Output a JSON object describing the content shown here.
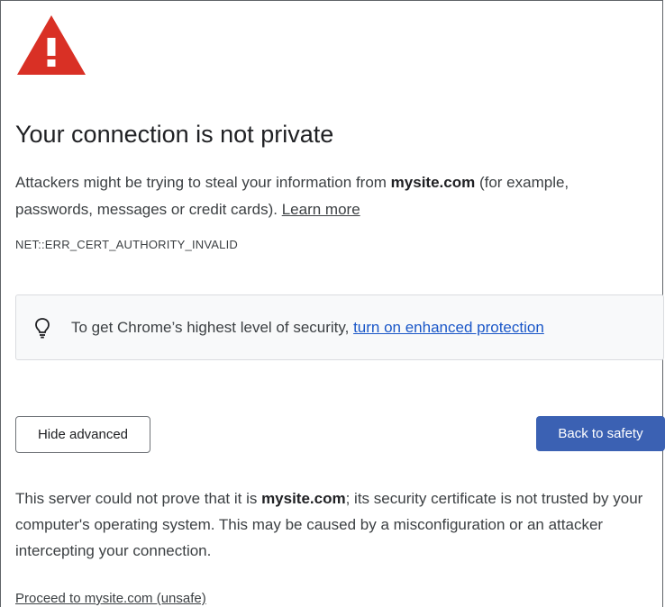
{
  "icons": {
    "warning": "warning-triangle-icon",
    "bulb": "lightbulb-icon"
  },
  "colors": {
    "warning_red": "#d93025",
    "link_blue": "#1a57c8",
    "primary_button": "#3b61b3",
    "box_background": "#f8f9fa"
  },
  "heading": "Your connection is not private",
  "description": {
    "part1": "Attackers might be trying to steal your information from ",
    "site": "mysite.com",
    "part2": " (for example, passwords, messages or credit cards). ",
    "learn_more": "Learn more"
  },
  "error_code": "NET::ERR_CERT_AUTHORITY_INVALID",
  "enhanced_protection": {
    "text": "To get Chrome’s highest level of security, ",
    "link": "turn on enhanced protection"
  },
  "buttons": {
    "hide_advanced": "Hide advanced",
    "back_to_safety": "Back to safety"
  },
  "details": {
    "part1": "This server could not prove that it is ",
    "site": "mysite.com",
    "part2": "; its security certificate is not trusted by your computer's operating system. This may be caused by a misconfiguration or an attacker intercepting your connection."
  },
  "proceed_link": "Proceed to mysite.com (unsafe)"
}
